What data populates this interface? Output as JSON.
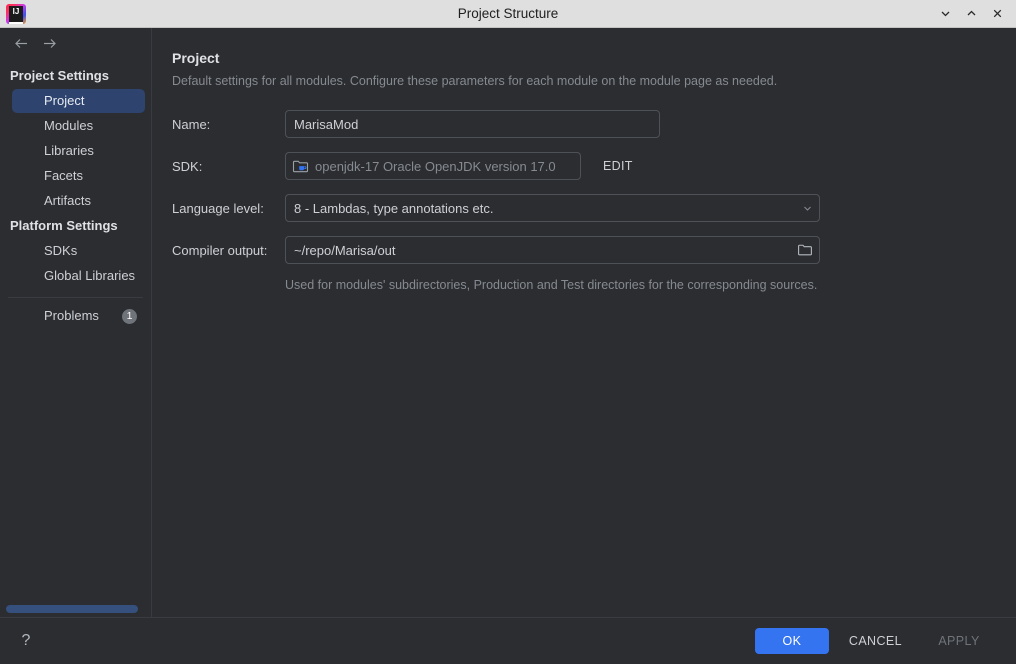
{
  "window": {
    "title": "Project Structure",
    "logo_text": "IJ",
    "controls": [
      {
        "name": "minimize-button",
        "glyph": "chevron-down"
      },
      {
        "name": "maximize-button",
        "glyph": "chevron-up"
      },
      {
        "name": "close-button",
        "glyph": "x"
      }
    ]
  },
  "nav": {
    "back_label": "Back",
    "forward_label": "Forward"
  },
  "sidebar": {
    "groups": [
      {
        "title": "Project Settings",
        "items": [
          {
            "label": "Project",
            "selected": true
          },
          {
            "label": "Modules",
            "selected": false
          },
          {
            "label": "Libraries",
            "selected": false
          },
          {
            "label": "Facets",
            "selected": false
          },
          {
            "label": "Artifacts",
            "selected": false
          }
        ]
      },
      {
        "title": "Platform Settings",
        "items": [
          {
            "label": "SDKs",
            "selected": false
          },
          {
            "label": "Global Libraries",
            "selected": false
          }
        ]
      }
    ],
    "problems": {
      "label": "Problems",
      "count": "1"
    }
  },
  "main": {
    "title": "Project",
    "subtitle": "Default settings for all modules. Configure these parameters for each module on the module page as needed.",
    "name_field": {
      "label": "Name:",
      "value": "MarisaMod",
      "placeholder": ""
    },
    "sdk_field": {
      "label": "SDK:",
      "value": "openjdk-17 Oracle OpenJDK version 17.0",
      "icon": "jdk-folder-icon",
      "edit_label": "EDIT"
    },
    "language_level": {
      "label": "Language level:",
      "value": "8 - Lambdas, type annotations etc."
    },
    "compiler_output": {
      "label": "Compiler output:",
      "value": "~/repo/Marisa/out",
      "browse_icon": "folder-icon",
      "hint": "Used for modules' subdirectories, Production and Test directories for the corresponding sources."
    }
  },
  "footer": {
    "help_label": "?",
    "ok_label": "OK",
    "cancel_label": "CANCEL",
    "apply_label": "APPLY"
  },
  "colors": {
    "accent": "#3574f0",
    "selection": "#2e436e",
    "panel_bg": "#2b2d30",
    "titlebar_bg": "#dfdfdf",
    "badge_bg": "#6f737a",
    "scrollbar": "#36507d"
  }
}
